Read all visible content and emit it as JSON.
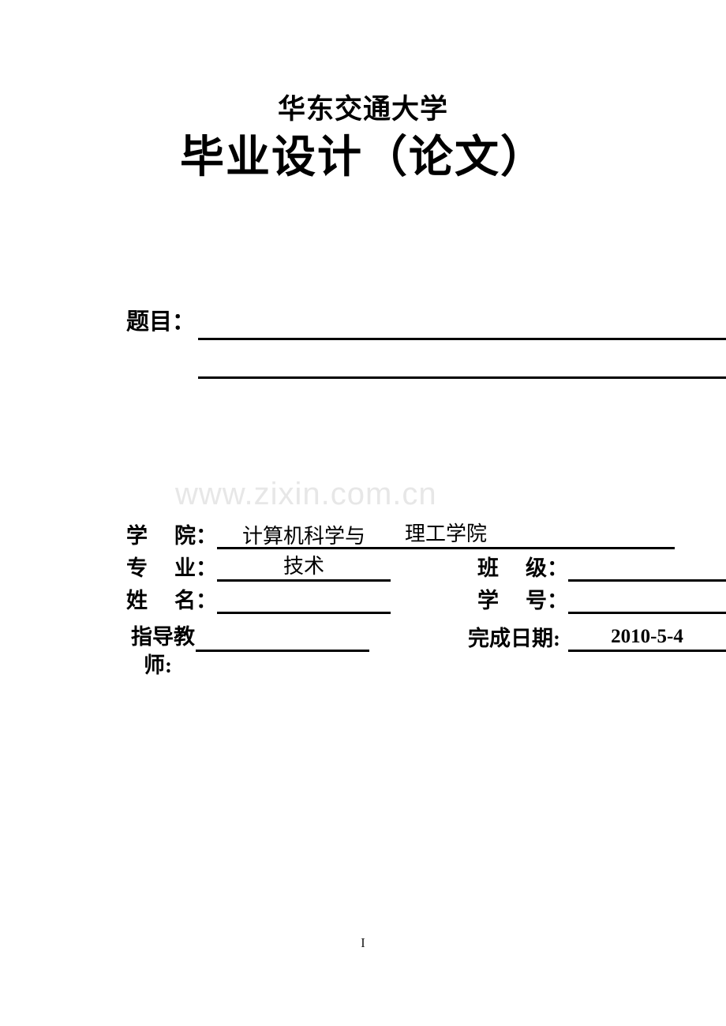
{
  "document": {
    "university": "华东交通大学",
    "title": "毕业设计（论文）",
    "page_number": "I"
  },
  "watermark": {
    "text": "www.zixin.com.cn",
    "color": "#e7e7e7"
  },
  "subject": {
    "label": "题目：",
    "line1_value": "",
    "line2_value": ""
  },
  "fields": {
    "college": {
      "label_char1": "学",
      "label_char2": "院",
      "colon": "：",
      "value": "理工学院"
    },
    "major": {
      "label_char1": "专",
      "label_char2": "业",
      "colon": "：",
      "value_line1": "计算机科学与",
      "value_line2": "技术"
    },
    "class": {
      "label_char1": "班",
      "label_char2": "级",
      "colon": "：",
      "value": ""
    },
    "name": {
      "label_char1": "姓",
      "label_char2": "名",
      "colon": "：",
      "value": ""
    },
    "student_id": {
      "label_char1": "学",
      "label_char2": "号",
      "colon": "：",
      "value": ""
    },
    "advisor": {
      "label_line1": "指导教",
      "label_line2": "师:",
      "value": ""
    },
    "completion_date": {
      "label": "完成日期:",
      "value": "2010-5-4"
    }
  }
}
